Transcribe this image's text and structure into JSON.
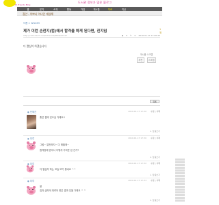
{
  "header": {
    "tagline": "도서관 정보가 많은 블로그",
    "logo_sub": "Hi Friends Blog"
  },
  "nav": {
    "items": [
      {
        "label": "홈"
      },
      {
        "label": "본지"
      },
      {
        "label": "소개"
      },
      {
        "label": "활동"
      },
      {
        "label": "가입"
      },
      {
        "label": "게시판"
      },
      {
        "label": "자료"
      },
      {
        "label": "지난"
      }
    ],
    "active_index": 6
  },
  "subbar": {
    "title": "집안 - 이쁘니 이나인 게임해"
  },
  "post": {
    "breadcrumb": "드롭 > WILKIM",
    "rank": "1위",
    "title": "제가 이런 손전지(컴)에서 합격을 하게 된다면, 진지임",
    "meta_left": "http://cafe.daum.net/hifriends/8P4Z/43127",
    "meta_date": "2010.01.17 17:00:33",
    "meta_views": "0",
    "meta_comments": "0",
    "body": "다 열심히 하겠습니다",
    "scrap_label": "게시물 스크랩",
    "scrap_btn1": "추천",
    "scrap_btn2": "스크랩",
    "list_button": "목록"
  },
  "comments": [
    {
      "name": "민혜진",
      "date": "2010.01.17 17:20",
      "text": "좋은 결과 있으실 거에요!!",
      "reply": "↳ 답글쓰기"
    },
    {
      "name": "미루",
      "date": "2010.01.17 17:30",
      "text_line1": "그럼~ 말만하지~ 다 해줄께~",
      "text_line2": "합격증에 받아서 이렇게 가여운 된 건가?",
      "reply": "↳ 답글쓰기"
    },
    {
      "name": "미루",
      "date": "2010.01.17 17:32",
      "text": "다 열심히 하는 모습 보기 좋네요 ^^",
      "reply": "↳ 답글쓰기"
    },
    {
      "name": "미루",
      "date": "2010.01.17 17:33",
      "text_line1": "웅",
      "text_line2": "집과 급하게 데려야 좋은 결과 있을 거에요 ^ ^",
      "reply": "↳ 답글쓰기"
    }
  ],
  "comment_actions": "수정 | 삭제",
  "colors": {
    "nav_bg": "#5a5a5a",
    "nav_active": "#f2e600",
    "link": "#5b8ab8",
    "pig_pink": "#f3a7c2",
    "tagline": "#d23b8c"
  }
}
